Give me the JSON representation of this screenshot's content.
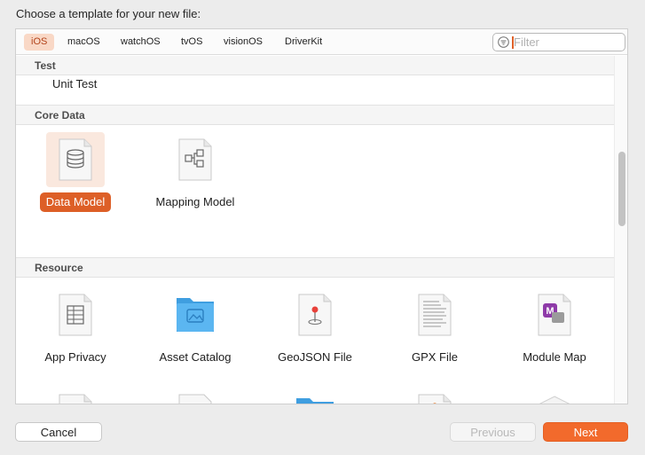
{
  "dialog": {
    "heading": "Choose a template for your new file:"
  },
  "tabs": [
    {
      "label": "iOS",
      "active": true
    },
    {
      "label": "macOS"
    },
    {
      "label": "watchOS"
    },
    {
      "label": "tvOS"
    },
    {
      "label": "visionOS"
    },
    {
      "label": "DriverKit"
    }
  ],
  "filter": {
    "placeholder": "Filter",
    "value": ""
  },
  "sections": {
    "test": {
      "title": "Test",
      "items": [
        "Unit Test"
      ]
    },
    "core_data": {
      "title": "Core Data",
      "items": [
        "Data Model",
        "Mapping Model"
      ],
      "selected": "Data Model"
    },
    "resource": {
      "title": "Resource",
      "items": [
        "App Privacy",
        "Asset Catalog",
        "GeoJSON File",
        "GPX File",
        "Module Map"
      ]
    }
  },
  "buttons": {
    "cancel": "Cancel",
    "previous": "Previous",
    "next": "Next"
  },
  "colors": {
    "accent": "#f26a2c",
    "selection": "#dd5f27",
    "tab_active_bg": "#f9d8c6"
  },
  "icons": {
    "filter": "filter-icon",
    "data_model": "database-document-icon",
    "mapping_model": "mapping-document-icon",
    "app_privacy": "table-document-icon",
    "asset_catalog": "blue-folder-icon",
    "geojson": "map-pin-document-icon",
    "gpx": "text-document-icon",
    "module_map": "module-map-icon",
    "strings": "table-document-icon",
    "rich_text": "rich-text-document-icon",
    "reality_folder": "reality-folder-icon",
    "scene": "scene-document-icon",
    "cube": "white-cube-icon"
  }
}
